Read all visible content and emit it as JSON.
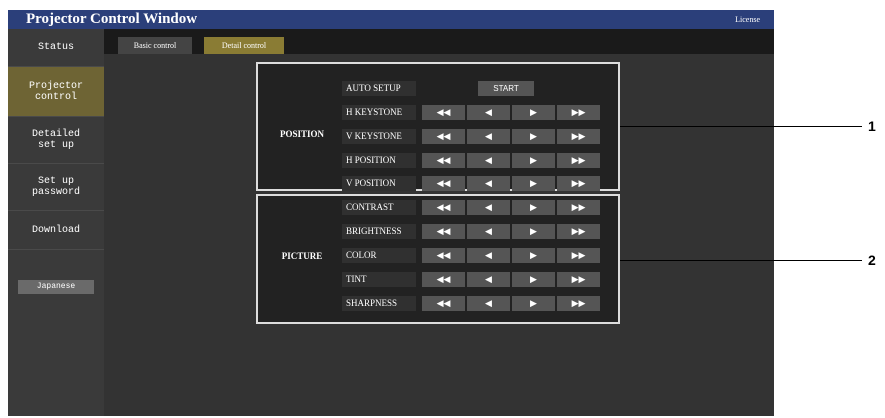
{
  "app": {
    "title": "Projector Control Window",
    "license_link": "License"
  },
  "sidebar": {
    "items": [
      {
        "label": "Status"
      },
      {
        "label": "Projector\ncontrol"
      },
      {
        "label": "Detailed\nset up"
      },
      {
        "label": "Set up\npassword"
      },
      {
        "label": "Download"
      }
    ],
    "language_button": "Japanese"
  },
  "tabs": {
    "basic": "Basic control",
    "detail": "Detail control"
  },
  "position": {
    "title": "POSITION",
    "auto_setup": "AUTO SETUP",
    "start": "START",
    "rows": [
      "H KEYSTONE",
      "V KEYSTONE",
      "H POSITION",
      "V POSITION"
    ]
  },
  "picture": {
    "title": "PICTURE",
    "rows": [
      "CONTRAST",
      "BRIGHTNESS",
      "COLOR",
      "TINT",
      "SHARPNESS"
    ]
  },
  "arrows": {
    "fast_left": "◀◀",
    "left": "◀",
    "right": "▶",
    "fast_right": "▶▶"
  },
  "callouts": {
    "one": "1",
    "two": "2"
  },
  "colors": {
    "titlebar": "#2b3f7a",
    "active_nav": "#6e6434",
    "active_tab": "#8a7c34"
  }
}
